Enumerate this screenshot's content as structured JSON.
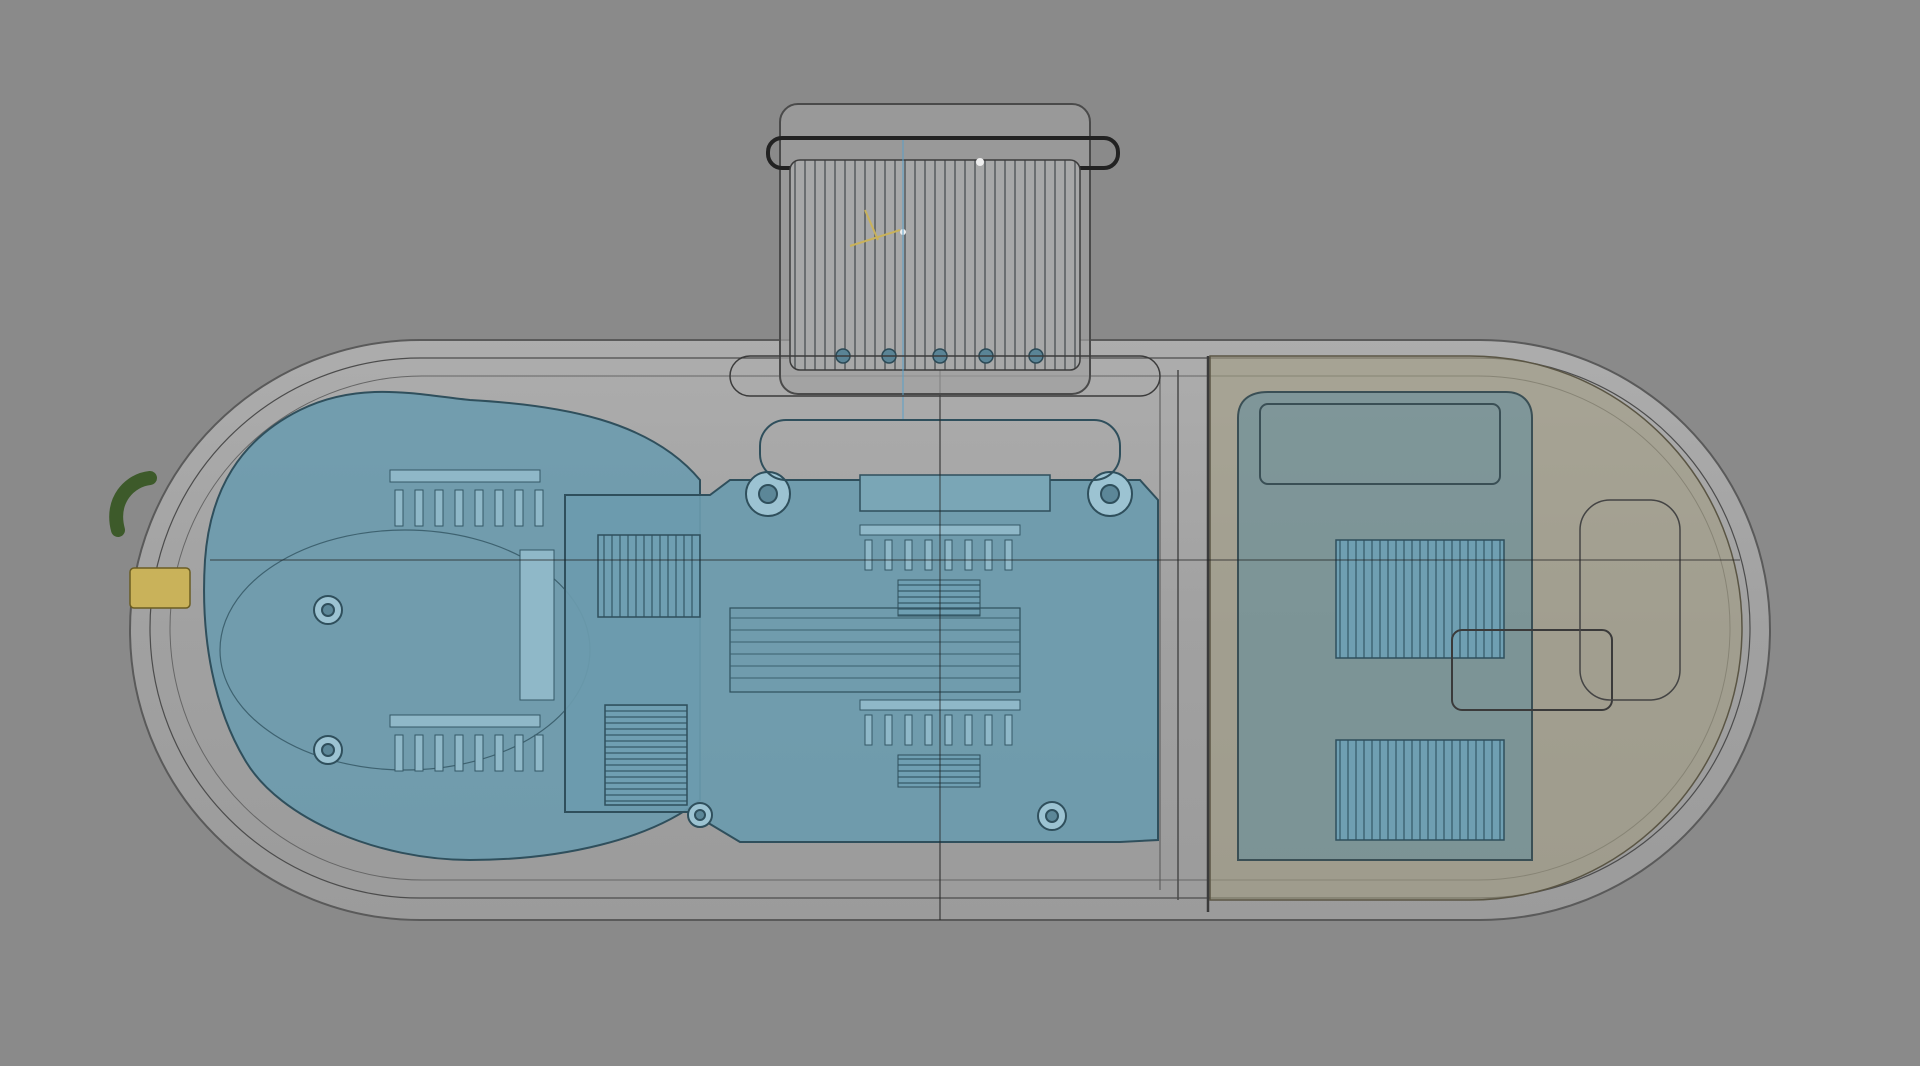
{
  "viewport": {
    "background": "#8a8a8a",
    "view": "transparent-x-ray-top-view"
  },
  "model": {
    "shell_color": "#a9a9a9",
    "shell_edge": "#4a4a4a",
    "pcb_color": "#6a98ab",
    "pcb_edge": "#2f4f5c",
    "battery_tint": "#9c9680",
    "gold_color": "#c9b25a",
    "green_color": "#3d5a2a",
    "icons": [
      "usb-connector-icon",
      "mounting-screw-icon",
      "battery-pack-icon",
      "flex-cable-icon"
    ]
  }
}
